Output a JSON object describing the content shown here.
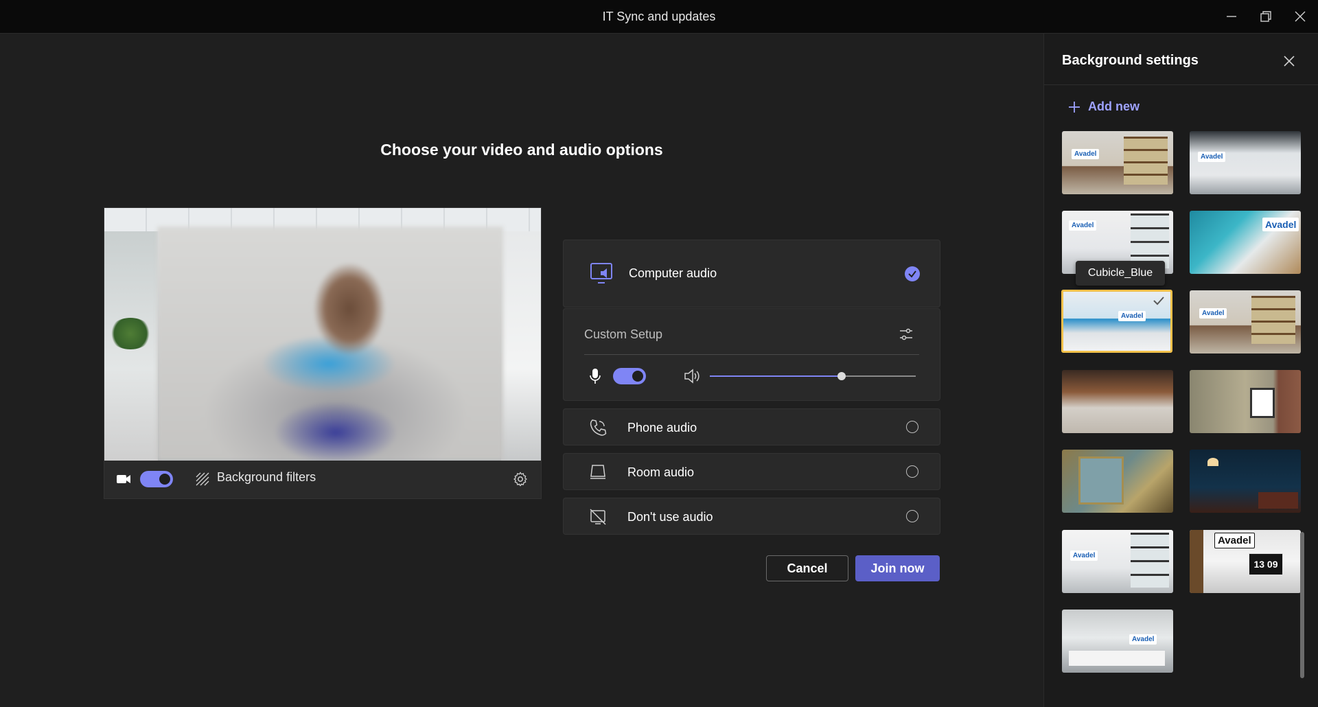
{
  "window": {
    "title": "IT Sync and updates",
    "controls": [
      "minimize-icon",
      "restore-icon",
      "close-icon"
    ]
  },
  "main": {
    "heading": "Choose your video and audio options",
    "video": {
      "camera_on": true,
      "background_filters_label": "Background filters",
      "icons": [
        "camera-icon",
        "background-filters-icon",
        "settings-gear-icon"
      ]
    },
    "audio": {
      "options": [
        {
          "label": "Computer audio",
          "icon": "computer-audio-icon",
          "selected": true
        },
        {
          "label": "Phone audio",
          "icon": "phone-icon",
          "selected": false
        },
        {
          "label": "Room audio",
          "icon": "room-audio-icon",
          "selected": false
        },
        {
          "label": "Don't use audio",
          "icon": "no-audio-icon",
          "selected": false
        }
      ],
      "custom_setup_label": "Custom Setup",
      "mic_on": true,
      "speaker_volume": 0.64
    },
    "buttons": {
      "cancel": "Cancel",
      "join": "Join now"
    }
  },
  "panel": {
    "title": "Background settings",
    "add_new": "Add new",
    "tooltip": "Cubicle_Blue",
    "selected_index": 4,
    "logo_text": "Avadel",
    "clock_text": "13 09",
    "thumbnails": [
      {
        "name": "office-wood-shelves"
      },
      {
        "name": "office-dark-windows"
      },
      {
        "name": "office-white-shelves"
      },
      {
        "name": "office-teal-wall"
      },
      {
        "name": "Cubicle_Blue"
      },
      {
        "name": "office-wood-desk"
      },
      {
        "name": "open-office-brick"
      },
      {
        "name": "concrete-wall-frame"
      },
      {
        "name": "loft-window"
      },
      {
        "name": "dark-blue-lounge"
      },
      {
        "name": "office-dark-windows-2"
      },
      {
        "name": "avadel-desk-clock"
      },
      {
        "name": "glass-meeting-room"
      }
    ]
  },
  "colors": {
    "accent": "#7f85f5",
    "primary_button": "#5b5fc7",
    "selected_border": "#f2c14b",
    "background": "#1f1f1f"
  }
}
